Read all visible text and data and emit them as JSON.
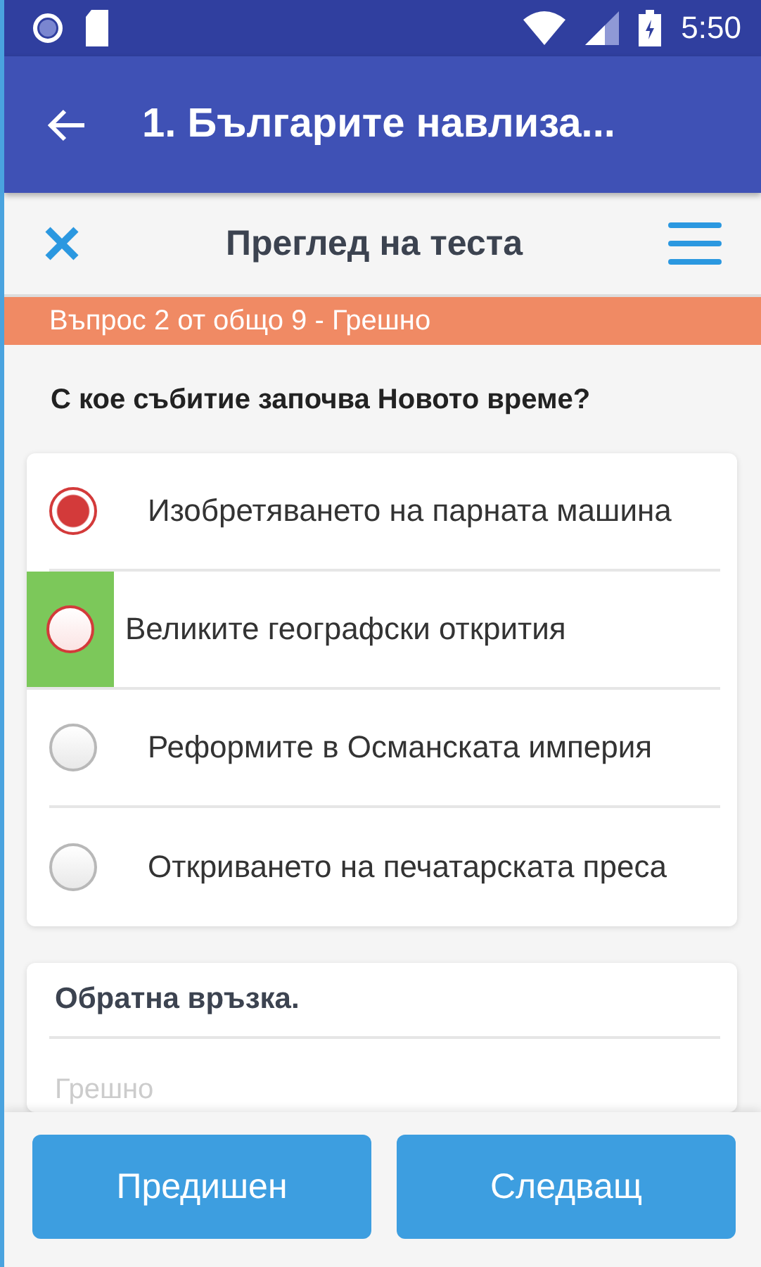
{
  "status_bar": {
    "time": "5:50"
  },
  "app_bar": {
    "title": "1. Българите навлиза..."
  },
  "review_header": {
    "title": "Преглед на теста"
  },
  "result_banner": {
    "text": "Въпрос 2 от общо 9 - Грешно",
    "correct": false
  },
  "question": {
    "text": "С кое събитие започва Новото време?"
  },
  "answers": [
    {
      "label": "Изобретяването на парната машина",
      "selected": true,
      "correct": false
    },
    {
      "label": "Великите географски открития",
      "selected": false,
      "correct": true
    },
    {
      "label": "Реформите в Османската империя",
      "selected": false,
      "correct": false
    },
    {
      "label": "Откриването на печатарската преса",
      "selected": false,
      "correct": false
    }
  ],
  "feedback": {
    "title": "Обратна връзка.",
    "text": "Грешно"
  },
  "buttons": [
    {
      "label": "Предишен"
    },
    {
      "label": "Следващ"
    }
  ]
}
